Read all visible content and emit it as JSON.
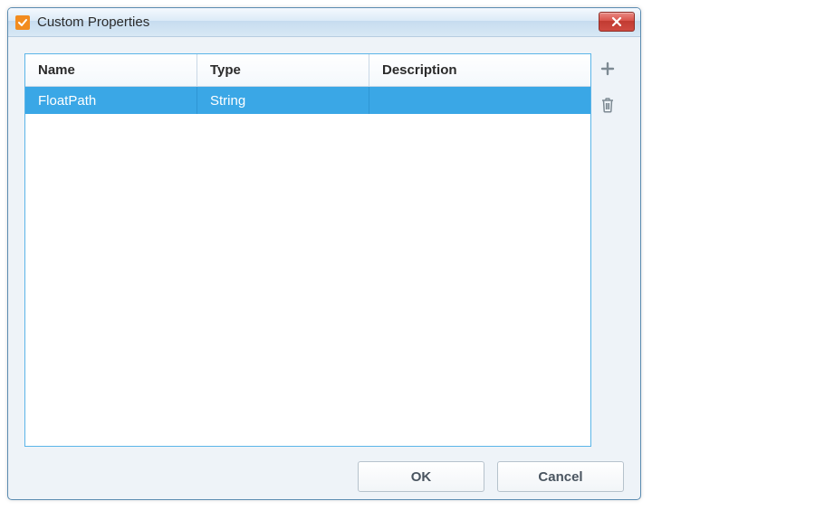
{
  "window": {
    "title": "Custom Properties"
  },
  "table": {
    "columns": {
      "name": "Name",
      "type": "Type",
      "description": "Description"
    },
    "rows": [
      {
        "name": "FloatPath",
        "type": "String",
        "description": ""
      }
    ]
  },
  "buttons": {
    "ok": "OK",
    "cancel": "Cancel"
  }
}
